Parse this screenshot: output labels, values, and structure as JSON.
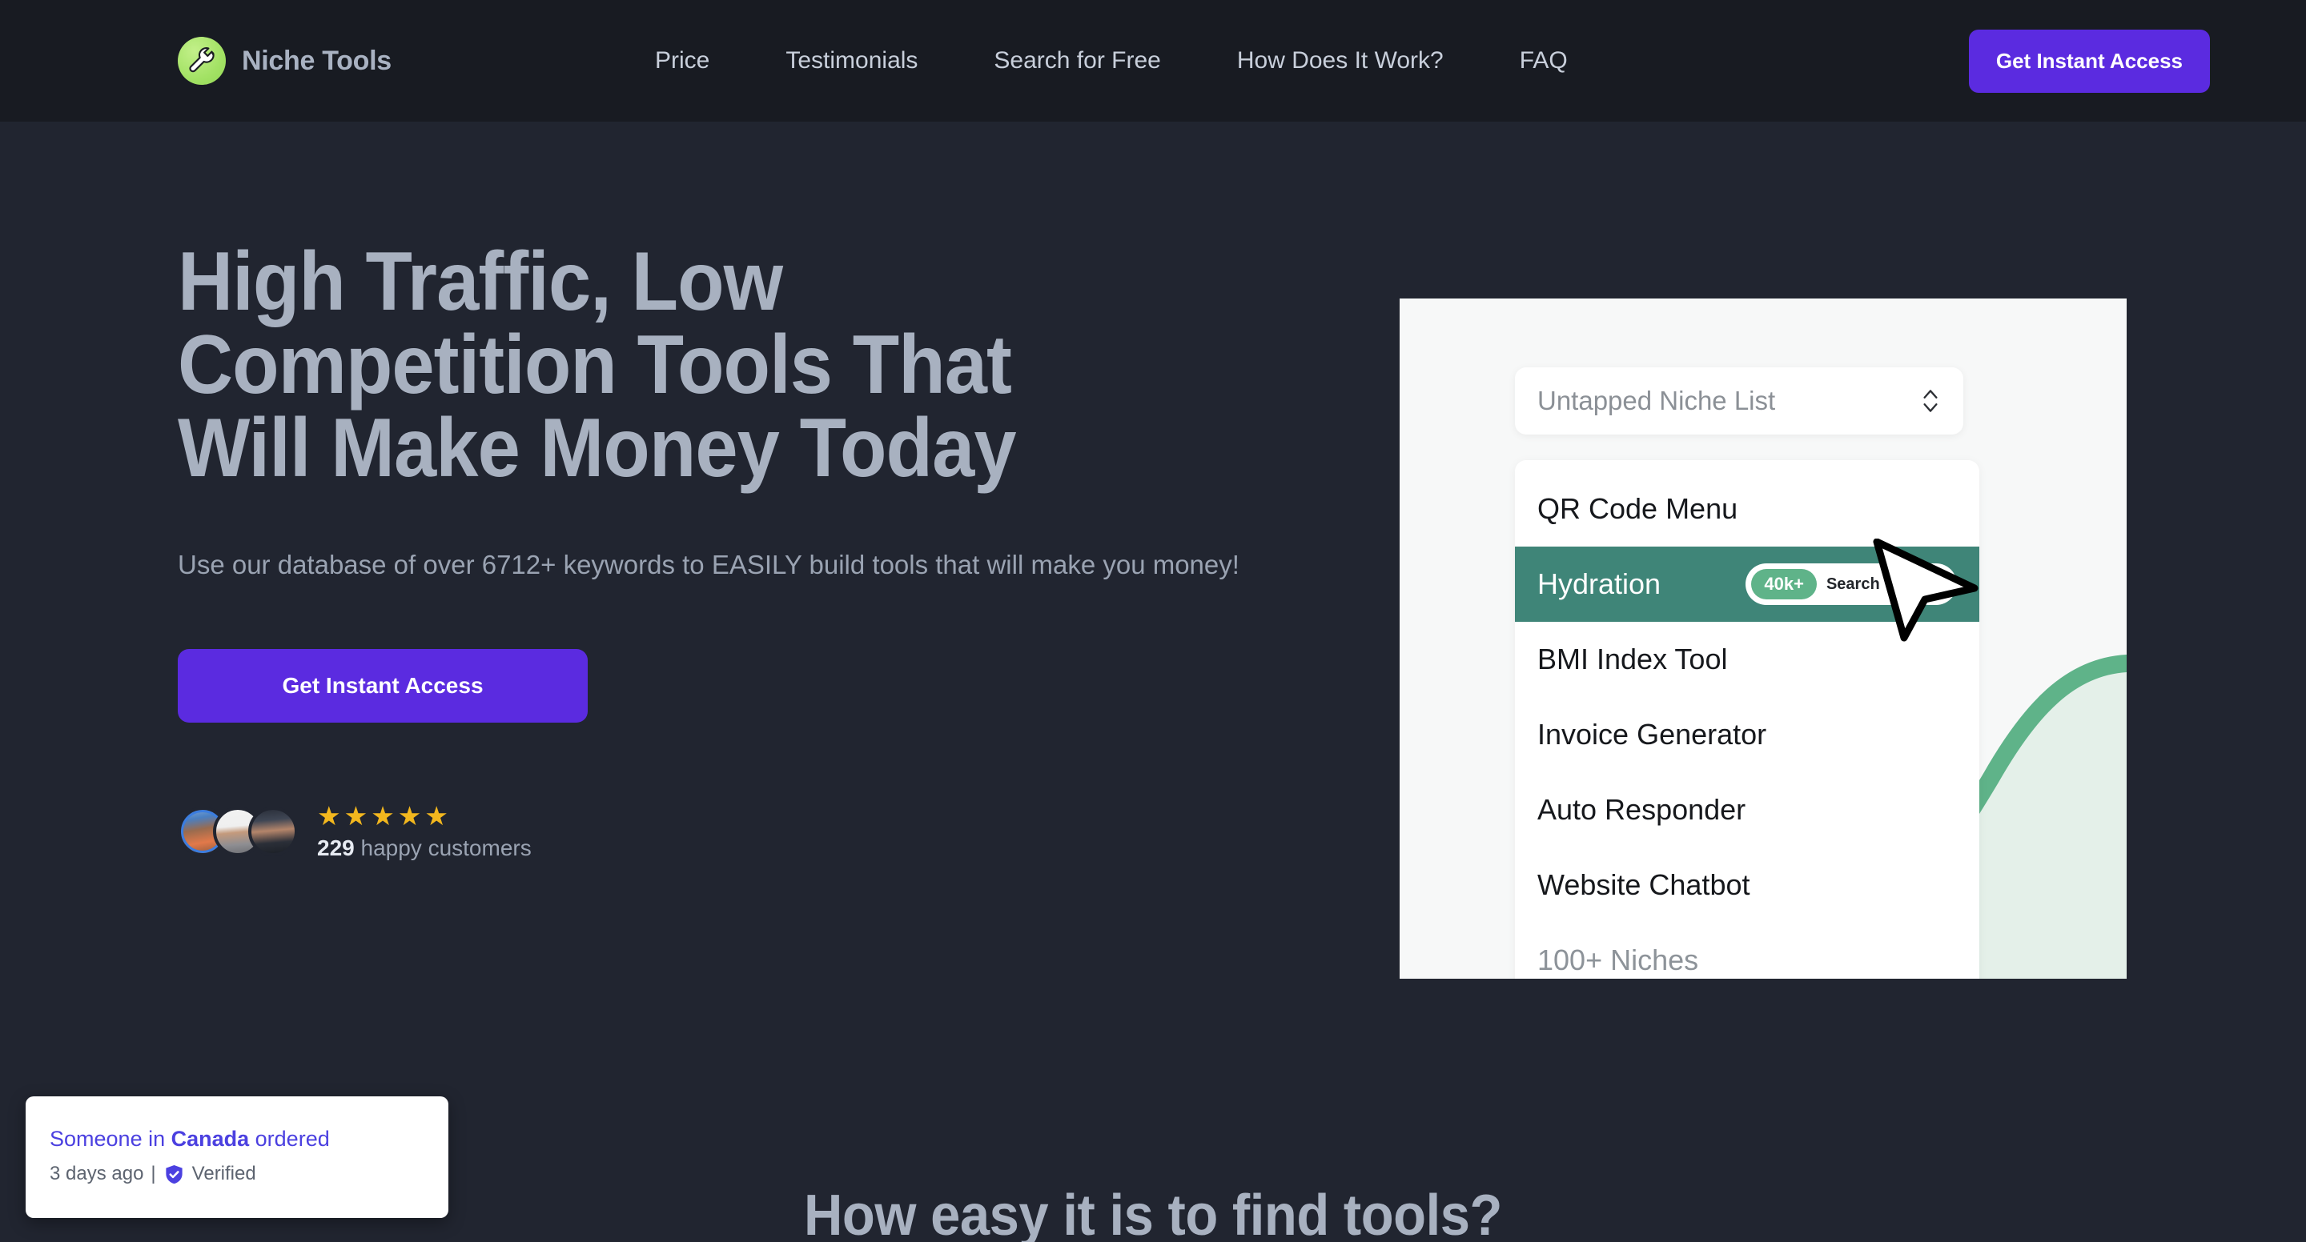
{
  "header": {
    "brand_name": "Niche Tools",
    "logo_icon": "wrench-icon",
    "logo_bg_color": "#a3e265",
    "nav": [
      {
        "label": "Price"
      },
      {
        "label": "Testimonials"
      },
      {
        "label": "Search for Free"
      },
      {
        "label": "How Does It Work?"
      },
      {
        "label": "FAQ"
      }
    ],
    "cta_label": "Get Instant Access",
    "cta_color": "#5b2be0",
    "background_color": "#181b22"
  },
  "hero": {
    "title_line1": "High Traffic, Low",
    "title_line2": "Competition Tools That",
    "title_line3": "Will Make Money Today",
    "subtitle": "Use our database of over 6712+ keywords to EASILY build tools that will make you money!",
    "cta_label": "Get Instant Access",
    "social_proof": {
      "avatar_count": 3,
      "stars": 5,
      "star_glyph": "★",
      "star_color": "#f2b71e",
      "count": "229",
      "count_suffix": " happy customers"
    }
  },
  "hero_panel": {
    "select_label": "Untapped Niche List",
    "select_icon": "chevron-up-down-icon",
    "items": [
      {
        "label": "QR Code Menu",
        "active": false,
        "muted": false
      },
      {
        "label": "Hydration",
        "active": true,
        "muted": false,
        "badge_value": "40k+",
        "badge_text": "Search Volume"
      },
      {
        "label": "BMI Index Tool",
        "active": false,
        "muted": false
      },
      {
        "label": "Invoice Generator",
        "active": false,
        "muted": false
      },
      {
        "label": "Auto Responder",
        "active": false,
        "muted": false
      },
      {
        "label": "Website Chatbot",
        "active": false,
        "muted": false
      },
      {
        "label": "100+ Niches",
        "active": false,
        "muted": true
      }
    ],
    "highlight_color": "#3f8578",
    "badge_pill_color": "#5fb389",
    "curve_color": "#5fb389",
    "cursor_icon": "cursor-arrow-icon"
  },
  "toast": {
    "prefix": "Someone in ",
    "location": "Canada",
    "suffix": " ordered",
    "time": "3 days ago",
    "separator": "|",
    "verified_label": "Verified",
    "verified_icon": "shield-check-icon",
    "accent_color": "#4b40e0"
  },
  "section": {
    "title": "How easy it is to find tools?"
  }
}
